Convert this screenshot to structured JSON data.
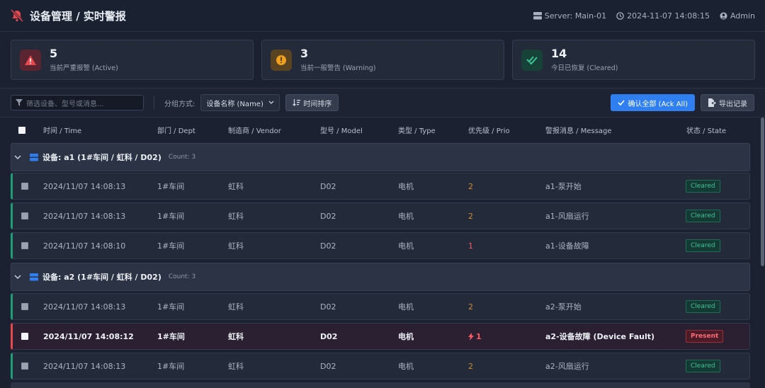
{
  "header": {
    "title": "设备管理 / 实时警报",
    "server": "Server: Main-01",
    "datetime": "2024-11-07 14:08:15",
    "user": "Admin"
  },
  "stats": [
    {
      "value": "5",
      "label": "当前严重报警 (Active)",
      "color": "#e5484d"
    },
    {
      "value": "3",
      "label": "当前一般警告 (Warning)",
      "color": "#f0a020"
    },
    {
      "value": "14",
      "label": "今日已恢复 (Cleared)",
      "color": "#3cc495"
    }
  ],
  "toolbar": {
    "filter_placeholder": "筛选设备、型号或消息...",
    "group_label": "分组方式:",
    "group_value": "设备名称 (Name)",
    "sort_label": "时间排序",
    "ack_label": "确认全部 (Ack All)",
    "export_label": "导出记录"
  },
  "columns": [
    "时间 / Time",
    "部门 / Dept",
    "制造商 / Vendor",
    "型号 / Model",
    "类型 / Type",
    "优先级 / Prio",
    "警报消息 / Message",
    "状态 / State"
  ],
  "groups": [
    {
      "name": "设备: a1 (1#车间 / 虹科 / D02)",
      "count": "Count: 3",
      "rows": [
        {
          "time": "2024/11/07 14:08:13",
          "dept": "1#车间",
          "vendor": "虹科",
          "model": "D02",
          "type": "电机",
          "prio": "2",
          "message": "a1-泵开始",
          "state": "Cleared"
        },
        {
          "time": "2024/11/07 14:08:13",
          "dept": "1#车间",
          "vendor": "虹科",
          "model": "D02",
          "type": "电机",
          "prio": "2",
          "message": "a1-风扇运行",
          "state": "Cleared"
        },
        {
          "time": "2024/11/07 14:08:10",
          "dept": "1#车间",
          "vendor": "虹科",
          "model": "D02",
          "type": "电机",
          "prio": "1",
          "message": "a1-设备故障",
          "state": "Cleared"
        }
      ]
    },
    {
      "name": "设备: a2 (1#车间 / 虹科 / D02)",
      "count": "Count: 3",
      "rows": [
        {
          "time": "2024/11/07 14:08:13",
          "dept": "1#车间",
          "vendor": "虹科",
          "model": "D02",
          "type": "电机",
          "prio": "2",
          "message": "a2-泵开始",
          "state": "Cleared"
        },
        {
          "time": "2024/11/07 14:08:12",
          "dept": "1#车间",
          "vendor": "虹科",
          "model": "D02",
          "type": "电机",
          "prio": "1",
          "message": "a2-设备故障 (Device Fault)",
          "state": "Present"
        },
        {
          "time": "2024/11/07 14:08:13",
          "dept": "1#车间",
          "vendor": "虹科",
          "model": "D02",
          "type": "电机",
          "prio": "2",
          "message": "a2-风扇运行",
          "state": "Cleared"
        }
      ]
    }
  ]
}
